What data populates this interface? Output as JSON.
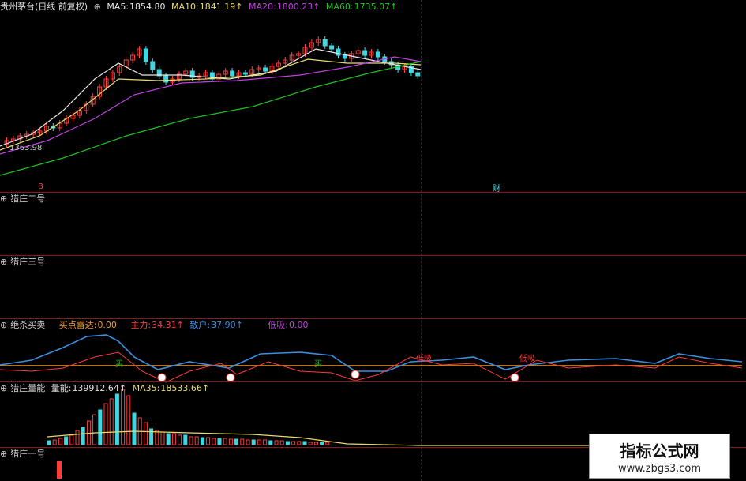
{
  "colors": {
    "bg": "#000000",
    "sep": "#8a1a1a",
    "red": "#ff3b3b",
    "cyan": "#3fd6e0",
    "white": "#e8e8e8",
    "yellow": "#e8dc6c",
    "magenta": "#c040e0",
    "green": "#1fc01f",
    "blue": "#3a8fe0",
    "orange": "#e89a30"
  },
  "main": {
    "title": "贵州茅台(日线 前复权)",
    "ma5": {
      "label": "MA5:",
      "value": "1854.80"
    },
    "ma10": {
      "label": "MA10:",
      "value": "1841.19↑"
    },
    "ma20": {
      "label": "MA20:",
      "value": "1800.23↑"
    },
    "ma60": {
      "label": "MA60:",
      "value": "1735.07↑"
    },
    "low_label": "1363.98",
    "marker_left": "B",
    "marker_right": "财"
  },
  "panel2": {
    "title": "猎庄二号"
  },
  "panel3": {
    "title": "猎庄三号"
  },
  "panel4": {
    "title": "绝杀买卖",
    "radar": {
      "label": "买点雷达:",
      "value": "0.00"
    },
    "main_force": {
      "label": "主力:",
      "value": "34.31↑"
    },
    "retail": {
      "label": "散户:",
      "value": "37.90↑"
    },
    "low_absorb": {
      "label": "低吸:",
      "value": "0.00"
    },
    "signal_buy": "买",
    "signal_absorb": "低吸"
  },
  "panel5": {
    "title": "猎庄量能",
    "volume": {
      "label": "量能:",
      "value": "139912.64↑"
    },
    "ma35": {
      "label": "MA35:",
      "value": "18533.66↑"
    }
  },
  "panel6": {
    "title": "猎庄一号"
  },
  "watermark": {
    "line1": "指标公式网",
    "line2": "www.zbgs3.com"
  }
}
